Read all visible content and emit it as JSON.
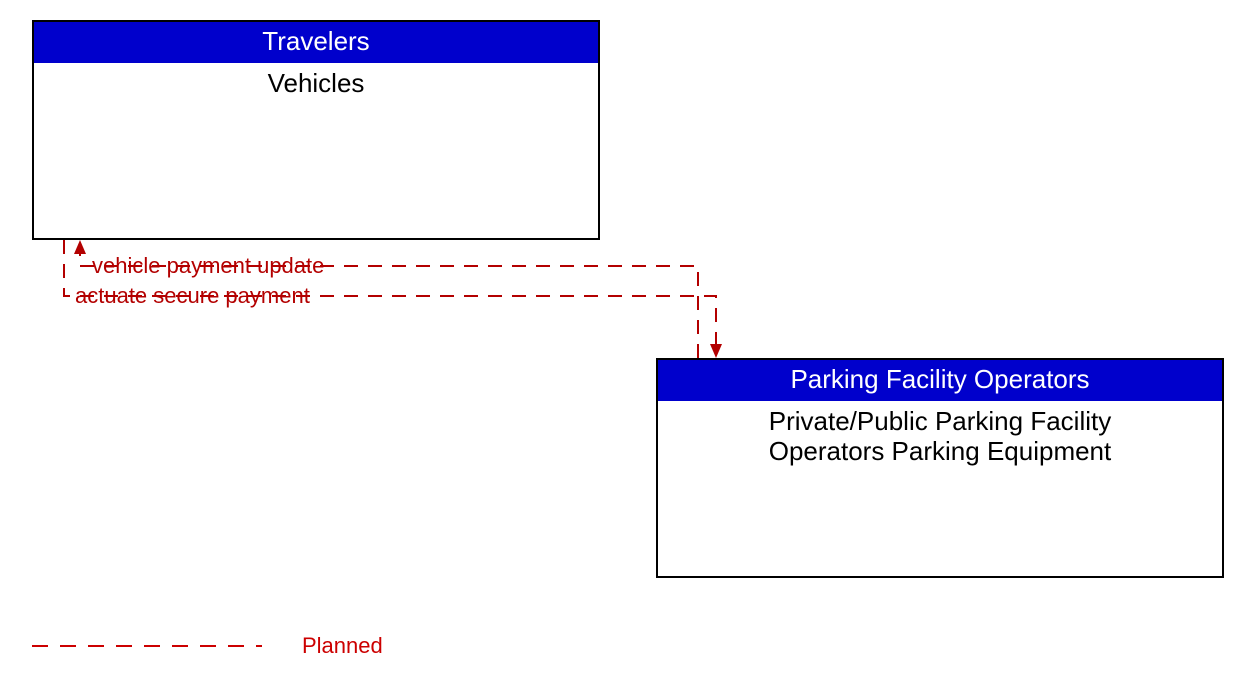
{
  "boxes": {
    "travelers": {
      "header": "Travelers",
      "body": "Vehicles"
    },
    "parking": {
      "header": "Parking Facility Operators",
      "body_line1": "Private/Public Parking Facility",
      "body_line2": "Operators Parking Equipment"
    }
  },
  "flows": {
    "to_travelers": "vehicle payment update",
    "to_parking": "actuate secure payment"
  },
  "legend": {
    "planned": "Planned"
  },
  "colors": {
    "header_bg": "#0000cc",
    "flow_stroke": "#b30000"
  }
}
